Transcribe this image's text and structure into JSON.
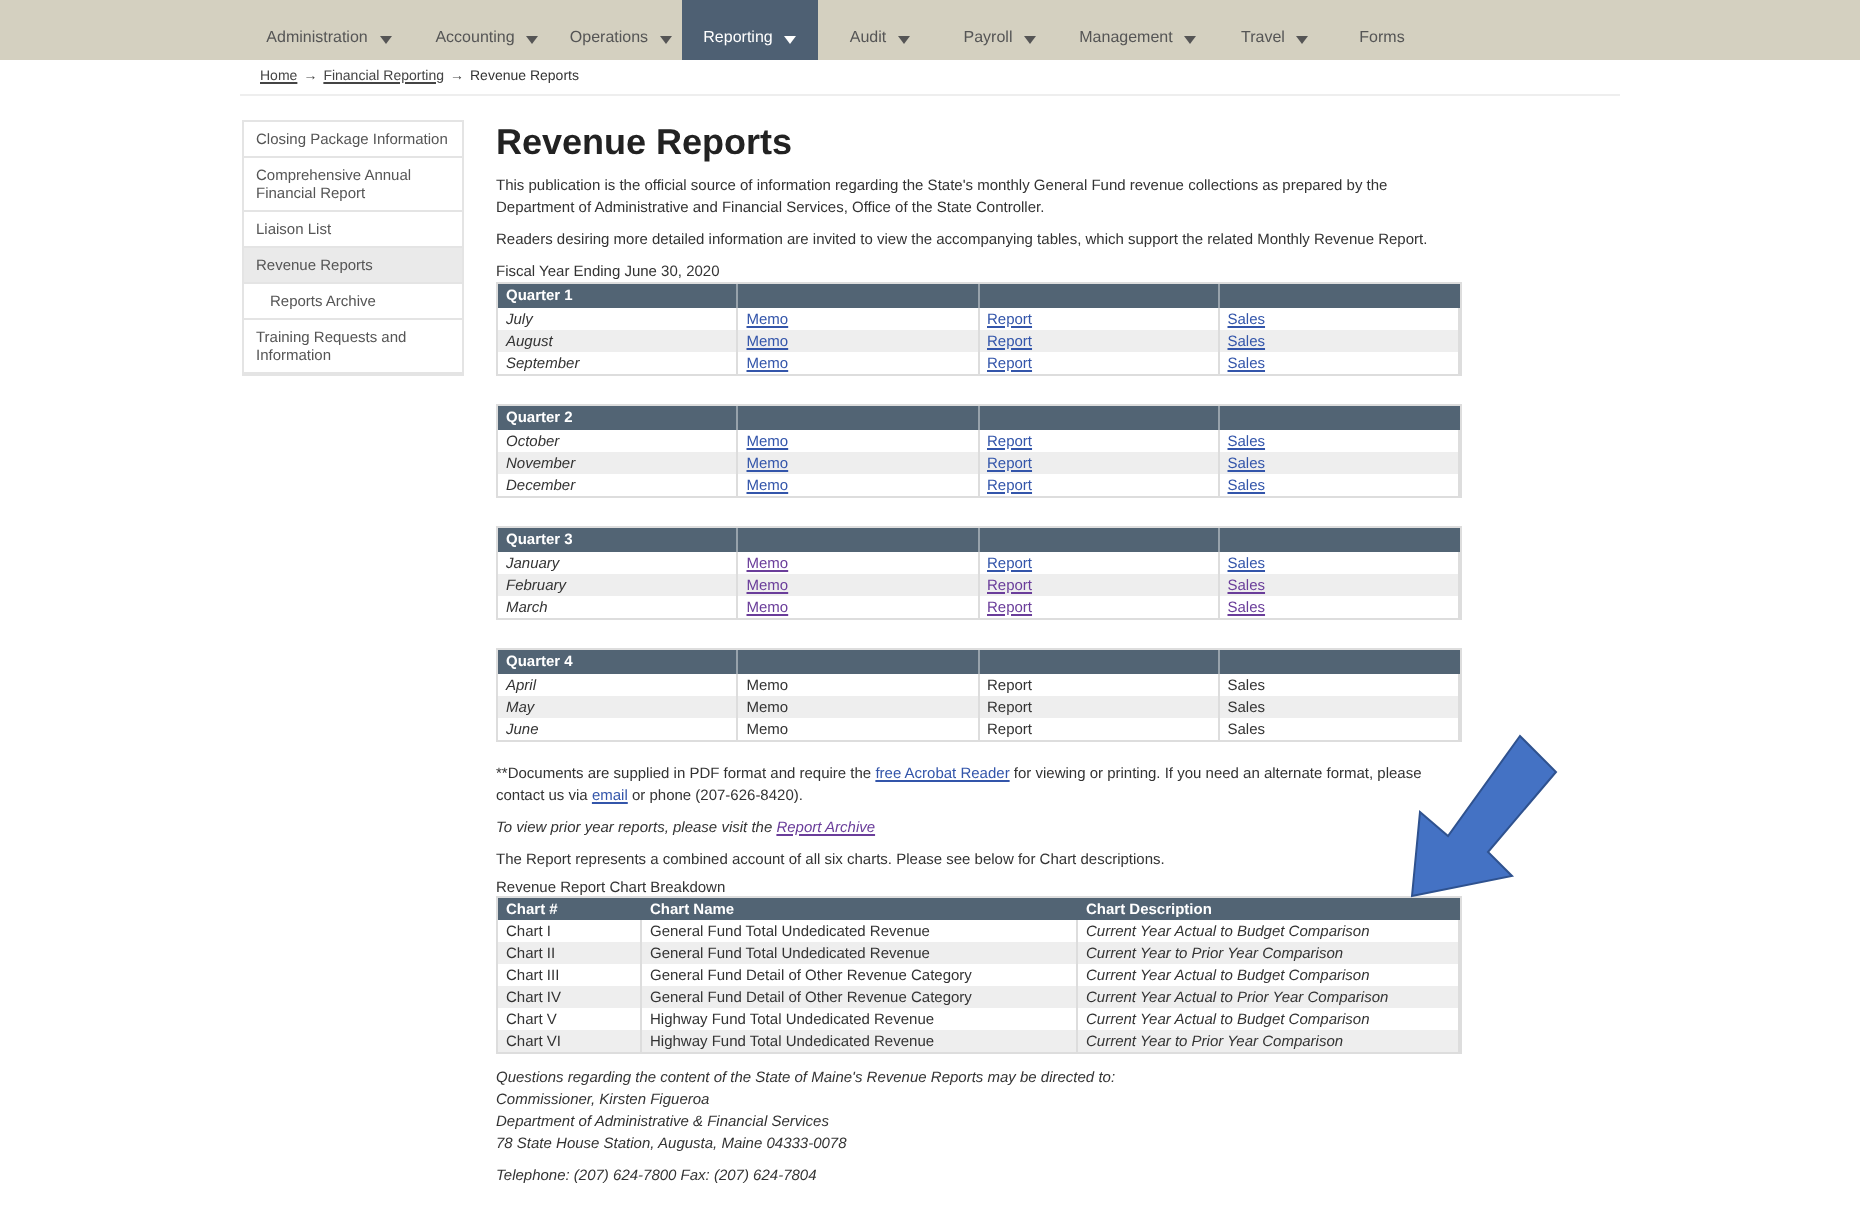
{
  "nav": [
    {
      "label": "Administration",
      "dropdown": true,
      "selected": false
    },
    {
      "label": "Accounting",
      "dropdown": true,
      "selected": false
    },
    {
      "label": "Operations",
      "dropdown": true,
      "selected": false
    },
    {
      "label": "Reporting",
      "dropdown": true,
      "selected": true
    },
    {
      "label": "Audit",
      "dropdown": true,
      "selected": false
    },
    {
      "label": "Payroll",
      "dropdown": true,
      "selected": false
    },
    {
      "label": "Management",
      "dropdown": true,
      "selected": false
    },
    {
      "label": "Travel",
      "dropdown": true,
      "selected": false
    },
    {
      "label": "Forms",
      "dropdown": false,
      "selected": false
    }
  ],
  "breadcrumb": {
    "items": [
      {
        "kind": "link",
        "text": "Home"
      },
      {
        "kind": "separator",
        "text": "→"
      },
      {
        "kind": "link",
        "text": "Financial Reporting"
      },
      {
        "kind": "separator",
        "text": "→"
      },
      {
        "kind": "current",
        "text": "Revenue Reports"
      }
    ]
  },
  "sidebar": {
    "items": [
      {
        "label": "Closing Package Information",
        "selected": false
      },
      {
        "label": "Comprehensive Annual Financial Report",
        "selected": false
      },
      {
        "label": "Liaison List",
        "selected": false
      },
      {
        "label": "Revenue Reports",
        "selected": true,
        "children": [
          {
            "label": "Reports Archive",
            "selected": false
          }
        ]
      },
      {
        "label": "Training Requests and Information",
        "selected": false
      }
    ]
  },
  "title": "Revenue Reports",
  "intro": [
    "This publication is the official source of information regarding the State's monthly General Fund revenue collections as prepared by the Department of Administrative and Financial Services, Office of the State Controller.",
    "Readers desiring more detailed information are invited to view the accompanying tables, which support the related Monthly Revenue Report."
  ],
  "fiscal_year": "Fiscal Year Ending June 30, 2020",
  "quarters": [
    {
      "heading": "Quarter 1",
      "rows": [
        {
          "month": "July",
          "cells": [
            {
              "text": "Memo",
              "link": true,
              "visited": false
            },
            {
              "text": "Report",
              "link": true,
              "visited": false
            },
            {
              "text": "Sales",
              "link": true,
              "visited": false
            }
          ]
        },
        {
          "month": "August",
          "cells": [
            {
              "text": "Memo",
              "link": true,
              "visited": false
            },
            {
              "text": "Report",
              "link": true,
              "visited": false
            },
            {
              "text": "Sales",
              "link": true,
              "visited": false
            }
          ]
        },
        {
          "month": "September",
          "cells": [
            {
              "text": "Memo",
              "link": true,
              "visited": false
            },
            {
              "text": "Report",
              "link": true,
              "visited": false
            },
            {
              "text": "Sales",
              "link": true,
              "visited": false
            }
          ]
        }
      ]
    },
    {
      "heading": "Quarter 2",
      "rows": [
        {
          "month": "October",
          "cells": [
            {
              "text": "Memo",
              "link": true,
              "visited": false
            },
            {
              "text": "Report",
              "link": true,
              "visited": false
            },
            {
              "text": "Sales",
              "link": true,
              "visited": false
            }
          ]
        },
        {
          "month": "November",
          "cells": [
            {
              "text": "Memo",
              "link": true,
              "visited": false
            },
            {
              "text": "Report",
              "link": true,
              "visited": false
            },
            {
              "text": "Sales",
              "link": true,
              "visited": false
            }
          ]
        },
        {
          "month": "December",
          "cells": [
            {
              "text": "Memo",
              "link": true,
              "visited": false
            },
            {
              "text": "Report",
              "link": true,
              "visited": false
            },
            {
              "text": "Sales",
              "link": true,
              "visited": false
            }
          ]
        }
      ]
    },
    {
      "heading": "Quarter 3",
      "rows": [
        {
          "month": "January",
          "cells": [
            {
              "text": "Memo",
              "link": true,
              "visited": true
            },
            {
              "text": "Report",
              "link": true,
              "visited": false
            },
            {
              "text": "Sales",
              "link": true,
              "visited": false
            }
          ]
        },
        {
          "month": "February",
          "cells": [
            {
              "text": "Memo",
              "link": true,
              "visited": true
            },
            {
              "text": "Report",
              "link": true,
              "visited": true
            },
            {
              "text": "Sales",
              "link": true,
              "visited": true
            }
          ]
        },
        {
          "month": "March",
          "cells": [
            {
              "text": "Memo",
              "link": true,
              "visited": true
            },
            {
              "text": "Report",
              "link": true,
              "visited": true
            },
            {
              "text": "Sales",
              "link": true,
              "visited": true
            }
          ]
        }
      ]
    },
    {
      "heading": "Quarter 4",
      "rows": [
        {
          "month": "April",
          "cells": [
            {
              "text": "Memo",
              "link": false
            },
            {
              "text": "Report",
              "link": false
            },
            {
              "text": "Sales",
              "link": false
            }
          ]
        },
        {
          "month": "May",
          "cells": [
            {
              "text": "Memo",
              "link": false
            },
            {
              "text": "Report",
              "link": false
            },
            {
              "text": "Sales",
              "link": false
            }
          ]
        },
        {
          "month": "June",
          "cells": [
            {
              "text": "Memo",
              "link": false
            },
            {
              "text": "Report",
              "link": false
            },
            {
              "text": "Sales",
              "link": false
            }
          ]
        }
      ]
    }
  ],
  "documents_note": {
    "parts": [
      {
        "kind": "text",
        "text": "**Documents are supplied in PDF format and require the "
      },
      {
        "kind": "link",
        "text": "free Acrobat Reader"
      },
      {
        "kind": "text",
        "text": " for viewing or printing. If you need an alternate format, please contact us via "
      },
      {
        "kind": "link",
        "text": "email"
      },
      {
        "kind": "text",
        "text": " or phone (207-626-8420)."
      }
    ]
  },
  "archive_note": {
    "text": "To view prior year reports, please visit the ",
    "link": "Report Archive"
  },
  "combined_note": "The Report represents a combined account of all six charts. Please see below for Chart descriptions.",
  "chart_table": {
    "caption": "Revenue Report Chart Breakdown",
    "columns": [
      "Chart #",
      "Chart Name",
      "Chart Description"
    ],
    "rows": [
      [
        "Chart I",
        "General Fund Total Undedicated Revenue",
        "Current Year Actual to Budget Comparison"
      ],
      [
        "Chart II",
        "General Fund Total Undedicated Revenue",
        "Current Year to Prior Year Comparison"
      ],
      [
        "Chart III",
        "General Fund Detail of Other Revenue Category",
        "Current Year Actual to Budget Comparison"
      ],
      [
        "Chart IV",
        "General Fund Detail of Other Revenue Category",
        "Current Year Actual to Prior Year Comparison"
      ],
      [
        "Chart V",
        "Highway Fund Total Undedicated Revenue",
        "Current Year Actual to Budget Comparison"
      ],
      [
        "Chart VI",
        "Highway Fund Total Undedicated Revenue",
        "Current Year to Prior Year Comparison"
      ]
    ]
  },
  "contact": {
    "lines": [
      "Questions regarding the content of the State of Maine's Revenue Reports may be directed to:",
      "Commissioner, Kirsten Figueroa",
      "Department of Administrative & Financial Services",
      "78 State House Station, Augusta, Maine 04333-0078"
    ],
    "telephone": "Telephone: (207) 624-7800 Fax: (207) 624-7804"
  }
}
